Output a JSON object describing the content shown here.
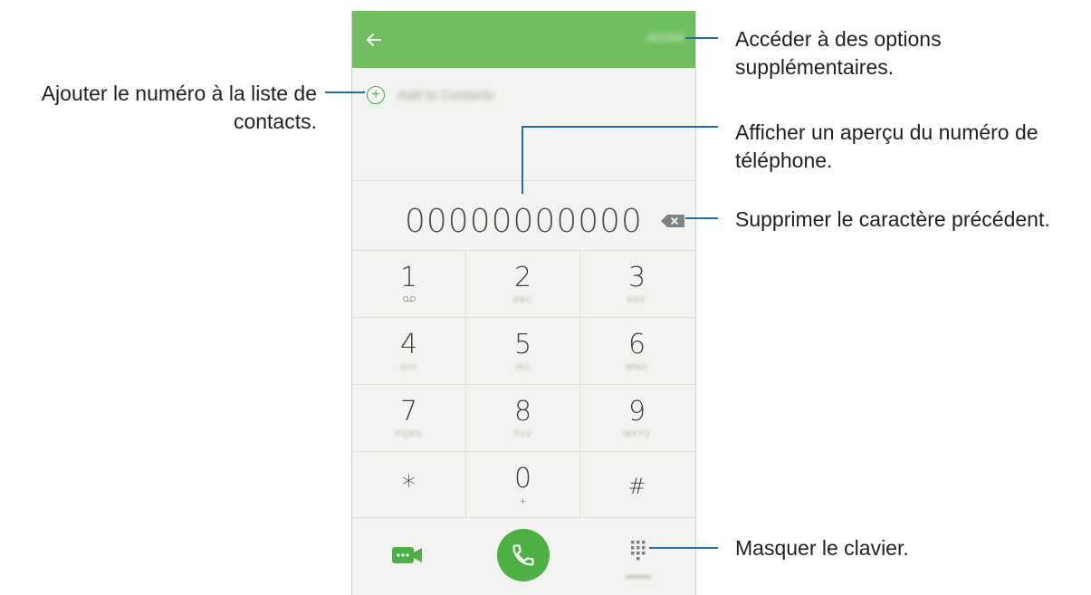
{
  "phone": {
    "appbar_color": "#6fbd5e",
    "back_icon": "arrow-left-icon",
    "more_label": "MORE",
    "add_to_contacts_label": "Add to Contacts",
    "number": "00000000000"
  },
  "keypad": {
    "keys": [
      {
        "digit": "1",
        "sub": "voicemail"
      },
      {
        "digit": "2",
        "sub": "ABC"
      },
      {
        "digit": "3",
        "sub": "DEF"
      },
      {
        "digit": "4",
        "sub": "GHI"
      },
      {
        "digit": "5",
        "sub": "JKL"
      },
      {
        "digit": "6",
        "sub": "MNO"
      },
      {
        "digit": "7",
        "sub": "PQRS"
      },
      {
        "digit": "8",
        "sub": "TUV"
      },
      {
        "digit": "9",
        "sub": "WXYZ"
      },
      {
        "digit": "*",
        "sub": ""
      },
      {
        "digit": "0",
        "sub": "+"
      },
      {
        "digit": "#",
        "sub": ""
      }
    ]
  },
  "bottom": {
    "call_color": "#4cb045",
    "hide_label": "HIDE"
  },
  "callouts": {
    "more_options_line1": "Accéder à des options",
    "more_options_line2": "supplémentaires.",
    "add_contact_line1": "Ajouter le numéro à la liste de",
    "add_contact_line2": "contacts.",
    "preview_line1": "Afficher un aperçu du numéro de",
    "preview_line2": "téléphone.",
    "delete": "Supprimer le caractère précédent.",
    "hide_keypad": "Masquer le clavier."
  },
  "callout_line_color": "#1d6fa5"
}
